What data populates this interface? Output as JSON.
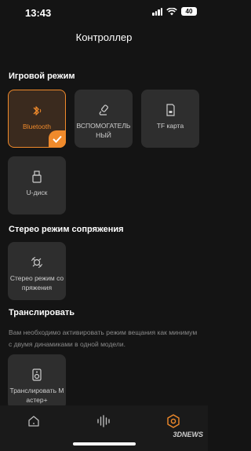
{
  "status": {
    "time": "13:43",
    "battery": "40"
  },
  "title": "Контроллер",
  "sections": {
    "game_mode": "Игровой режим",
    "stereo": "Стерео режим сопряжения",
    "broadcast": "Транслировать"
  },
  "tiles": {
    "bluetooth": "Bluetooth",
    "auxiliary": "ВСПОМОГАТЕЛЬНЫЙ",
    "tf_card": "TF карта",
    "usb": "U-диск",
    "stereo_pair": "Стерео режим сопряжения",
    "broadcast_master": "Транслировать Мастер+"
  },
  "broadcast_description": "Вам необходимо активировать режим вещания как минимум с двумя динамиками в одной модели.",
  "watermark": "3DNEWS",
  "colors": {
    "accent": "#f08a2b",
    "tile": "#2e2e2e",
    "background": "#141414"
  },
  "icons": {
    "bluetooth": "bluetooth-icon",
    "auxiliary": "aux-cable-icon",
    "tf_card": "sd-card-icon",
    "usb": "usb-drive-icon",
    "stereo_pair": "stereo-pair-icon",
    "broadcast": "speaker-icon",
    "tab_home": "home-icon",
    "tab_equalizer": "sound-wave-icon",
    "tab_settings": "hexagon-settings-icon"
  }
}
